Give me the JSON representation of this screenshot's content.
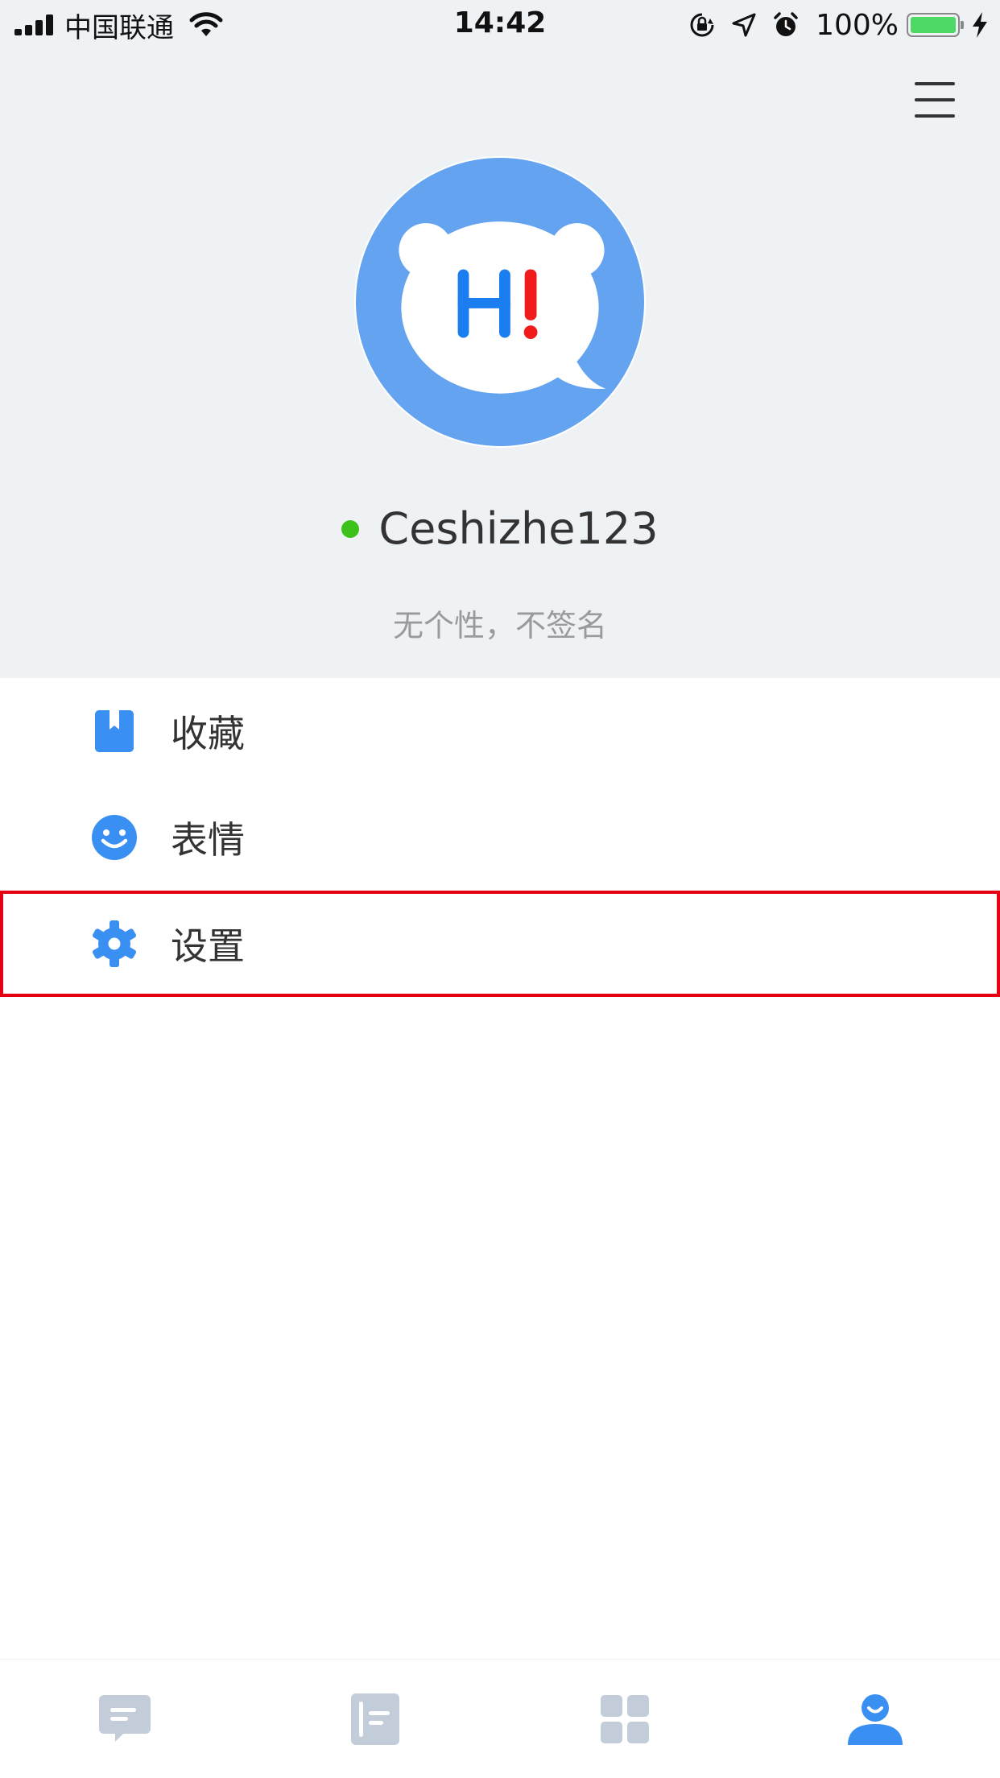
{
  "status_bar": {
    "carrier": "中国联通",
    "time": "14:42",
    "battery": "100%",
    "icons": [
      "signal-icon",
      "wifi-icon",
      "orientation-lock-icon",
      "location-icon",
      "alarm-icon",
      "battery-icon",
      "charging-icon"
    ]
  },
  "profile": {
    "avatar_text_h": "H",
    "avatar_text_bang": "!",
    "username": "Ceshizhe123",
    "signature": "无个性，不签名",
    "online_color": "#3cc21a"
  },
  "menu": {
    "items": [
      {
        "label": "收藏",
        "icon": "bookmark-icon"
      },
      {
        "label": "表情",
        "icon": "smiley-icon"
      },
      {
        "label": "设置",
        "icon": "gear-icon"
      }
    ],
    "selected_index": 2
  },
  "tab_bar": {
    "tabs": [
      {
        "icon": "chat-icon",
        "active": false
      },
      {
        "icon": "contacts-icon",
        "active": false
      },
      {
        "icon": "apps-grid-icon",
        "active": false
      },
      {
        "icon": "profile-icon",
        "active": true
      }
    ]
  },
  "colors": {
    "accent": "#3a8ff2",
    "header_bg": "#eff2f5",
    "avatar_bg": "#63a3ef",
    "tab_inactive": "#c3ccd9",
    "highlight_border": "#e60012",
    "h_letter": "#1a7ef0",
    "bang_color": "#f01c1c"
  }
}
